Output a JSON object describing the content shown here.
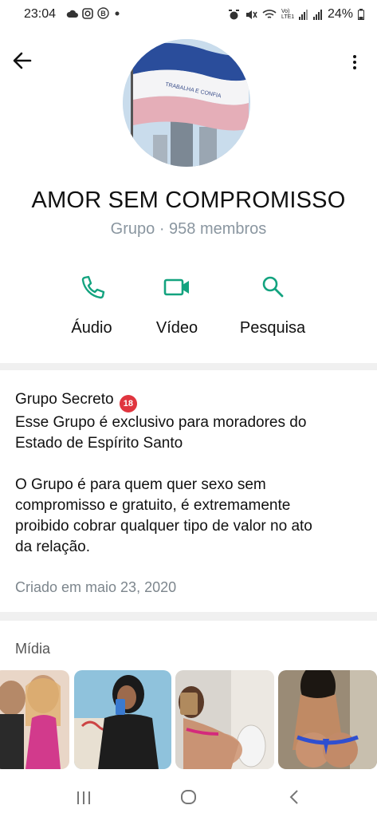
{
  "status_bar": {
    "time": "23:04",
    "battery": "24%",
    "network_label": "Vo) LTE1"
  },
  "header": {
    "group_name": "AMOR SEM COMPROMISSO",
    "group_meta": "Grupo · 958 membros",
    "avatar_flag_text": "TRABALHA E CONFIA"
  },
  "actions": [
    {
      "label": "Áudio",
      "icon": "phone-icon"
    },
    {
      "label": "Vídeo",
      "icon": "video-icon"
    },
    {
      "label": "Pesquisa",
      "icon": "search-icon"
    }
  ],
  "about": {
    "line1": "Grupo Secreto",
    "badge": "18",
    "line2": "Esse Grupo é exclusivo para moradores do",
    "line3": "Estado de Espírito Santo",
    "paragraph2": [
      "O Grupo é para quem quer sexo sem",
      "compromisso e gratuito, é extremamente",
      "proibido cobrar qualquer tipo de valor no ato",
      "da relação."
    ],
    "created": "Criado em maio 23, 2020"
  },
  "media": {
    "title": "Mídia",
    "thumb_count": 4
  },
  "colors": {
    "accent": "#13a37f",
    "meta_text": "#8a96a0",
    "background": "#f0f0f0"
  }
}
